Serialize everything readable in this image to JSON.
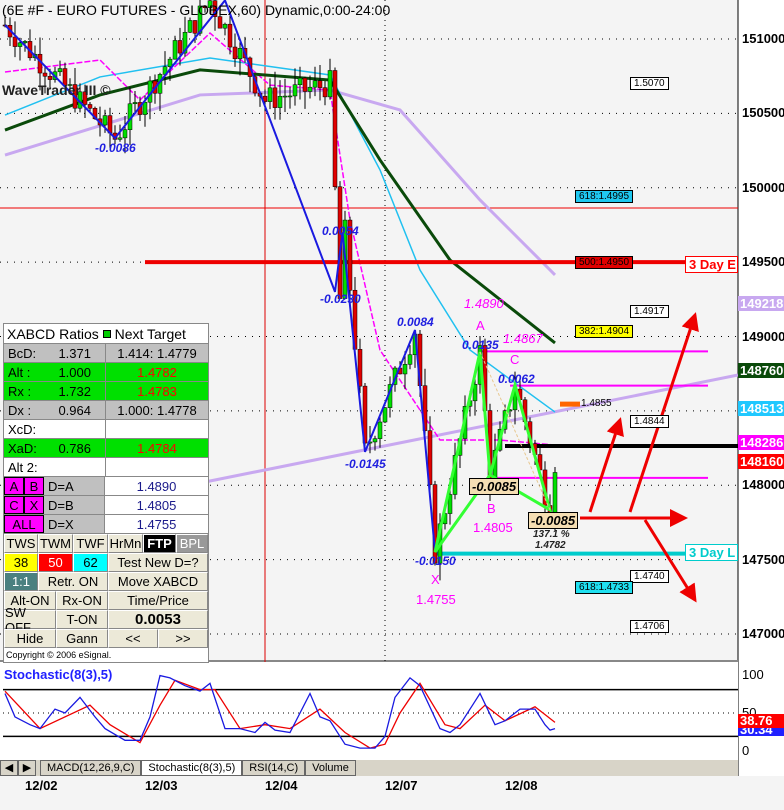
{
  "title": "(6E #F - EURO FUTURES - GLOBEX,60) Dynamic,0:00-24:00",
  "watermark": "WaveTrader III ©",
  "panel": {
    "header": "XABCD Ratios",
    "header2": "Next Target",
    "rows": [
      {
        "label": "BcD:",
        "value": "1.371",
        "target": "1.414: 1.4779",
        "style": "gray"
      },
      {
        "label": "Alt  :",
        "value": "1.000",
        "target": "1.4782",
        "style": "green"
      },
      {
        "label": "Rx   :",
        "value": "1.732",
        "target": "1.4783",
        "style": "green"
      },
      {
        "label": "Dx   :",
        "value": "0.964",
        "target": "1.000: 1.4778",
        "style": "gray"
      },
      {
        "label": "XcD:",
        "value": "",
        "target": "",
        "style": "white"
      },
      {
        "label": "XaD:",
        "value": "0.786",
        "target": "1.4784",
        "style": "green"
      },
      {
        "label": "Alt 2:",
        "value": "",
        "target": "",
        "style": "white"
      }
    ],
    "points": [
      {
        "a": "A",
        "b": "B",
        "label": "D=A",
        "value": "1.4890"
      },
      {
        "a": "C",
        "b": "X",
        "label": "D=B",
        "value": "1.4805"
      },
      {
        "a": "ALL",
        "b": "",
        "label": "D=X",
        "value": "1.4755"
      }
    ],
    "buttons": {
      "tws": "TWS",
      "twm": "TWM",
      "twf": "TWF",
      "hrmn": "HrMn",
      "ftp": "FTP",
      "bpl": "BPL",
      "n38": "38",
      "n50": "50",
      "n62": "62",
      "test": "Test New D=?",
      "r11": "1:1",
      "retr": "Retr. ON",
      "move": "Move XABCD",
      "alt": "Alt-ON",
      "rx": "Rx-ON",
      "tp": "Time/Price",
      "sw": "SW OFF",
      "ton": "T-ON",
      "tpval": "0.0053",
      "hide": "Hide",
      "gann": "Gann",
      "prev": "<<",
      "next": ">>"
    },
    "copyright": "Copyright © 2006 eSignal."
  },
  "axis": {
    "labels": [
      "151000",
      "150500",
      "150000",
      "149500",
      "149000",
      "148000",
      "147500",
      "147000"
    ],
    "badges": [
      {
        "v": "149218",
        "c": "#c8a8f0"
      },
      {
        "v": "148760",
        "c": "#0a4a0a"
      },
      {
        "v": "148513",
        "c": "#20c8ff"
      },
      {
        "v": "148286",
        "c": "#ff00ff"
      },
      {
        "v": "148160",
        "c": "#ff0000"
      }
    ]
  },
  "levels": {
    "boxes": [
      {
        "t": "1.5070",
        "p": 150700,
        "bg": "#fff"
      },
      {
        "t": "618:1.4995",
        "p": 149950,
        "bg": "#20c8f0"
      },
      {
        "t": "500:1.4950",
        "p": 149500,
        "bg": "#e00000"
      },
      {
        "t": "1.4917",
        "p": 149170,
        "bg": "#fff"
      },
      {
        "t": "382:1.4904",
        "p": 149040,
        "bg": "#ffff00"
      },
      {
        "t": "1.4844",
        "p": 148440,
        "bg": "#fff"
      },
      {
        "t": "1.4740",
        "p": 147400,
        "bg": "#fff"
      },
      {
        "t": "618:1.4733",
        "p": 147330,
        "bg": "#20e0f0"
      },
      {
        "t": "1.4706",
        "p": 147060,
        "bg": "#fff"
      }
    ],
    "orange_label": "1.4855",
    "day_high": "3 Day E",
    "day_low": "3 Day L"
  },
  "pattern": {
    "swing_labels": [
      "-0.0086",
      "0.0054",
      "-0.0230",
      "0.0084",
      "-0.0145",
      "0.0135",
      "0.0062",
      "-0.0150"
    ],
    "A": "A",
    "A_price": "1.4890",
    "B": "B",
    "B_price": "1.4805",
    "C": "C",
    "C_price": "1.4867",
    "X": "X",
    "X_price": "1.4755",
    "B_box": "-0.0085",
    "D_box": "-0.0085",
    "D_pct": "137.1 %",
    "D_price": "1.4782"
  },
  "stoch": {
    "label": "Stochastic(8(3),5)",
    "axis": [
      "100",
      "50",
      "0"
    ],
    "value_red": "38.76",
    "value_blue": "30.34"
  },
  "tabs": [
    "MACD(12,26,9,C)",
    "Stochastic(8(3),5)",
    "RSI(14,C)",
    "Volume"
  ],
  "dates": [
    "12/02",
    "12/03",
    "12/04",
    "12/07",
    "12/08"
  ],
  "chart_data": {
    "type": "candlestick",
    "ylim": [
      146900,
      151250
    ],
    "swings": [
      [
        0,
        151094
      ],
      [
        22,
        150334
      ],
      [
        41,
        151260
      ],
      [
        52,
        150590
      ],
      [
        65,
        150700
      ],
      [
        67,
        149250
      ],
      [
        68,
        149700
      ],
      [
        72,
        148224
      ],
      [
        82,
        149044
      ],
      [
        86,
        147551
      ],
      [
        95,
        148896
      ],
      [
        97,
        148069
      ],
      [
        102,
        148674
      ],
      [
        109,
        147834
      ],
      [
        110,
        148160
      ]
    ],
    "zigzag": [
      [
        0,
        151094
      ],
      [
        22,
        150334
      ],
      [
        44,
        151260
      ],
      [
        66,
        149300
      ],
      [
        67.5,
        149700
      ],
      [
        72,
        148224
      ],
      [
        82,
        149044
      ],
      [
        86,
        147551
      ]
    ],
    "xabcd": {
      "X": [
        86,
        147551
      ],
      "A": [
        95,
        148896
      ],
      "B": [
        97,
        148069
      ],
      "C": [
        102,
        148674
      ],
      "D": [
        109,
        147834
      ]
    },
    "ma_green": [
      [
        0,
        150388
      ],
      [
        19,
        150624
      ],
      [
        39,
        150792
      ],
      [
        65,
        150724
      ],
      [
        75,
        150187
      ],
      [
        89,
        149514
      ],
      [
        110,
        148957
      ]
    ],
    "ma_cyan": [
      [
        0,
        150489
      ],
      [
        19,
        150745
      ],
      [
        41,
        150872
      ],
      [
        65,
        150758
      ],
      [
        75,
        150120
      ],
      [
        83,
        149447
      ],
      [
        93,
        148909
      ],
      [
        110,
        148492
      ]
    ],
    "ma_magenta": [
      [
        0,
        150778
      ],
      [
        19,
        150859
      ],
      [
        27,
        150590
      ],
      [
        41,
        151040
      ],
      [
        53,
        150690
      ],
      [
        65,
        150657
      ],
      [
        69,
        149783
      ],
      [
        75,
        148909
      ],
      [
        87,
        148304
      ],
      [
        99,
        148304
      ],
      [
        110,
        148270
      ]
    ],
    "ma_lavender": [
      [
        0,
        150220
      ],
      [
        39,
        150624
      ],
      [
        65,
        150657
      ],
      [
        79,
        150523
      ],
      [
        95,
        149918
      ],
      [
        110,
        149414
      ]
    ],
    "stoch_blue": [
      [
        0,
        75
      ],
      [
        2,
        45
      ],
      [
        5,
        35
      ],
      [
        7,
        30
      ],
      [
        10,
        55
      ],
      [
        12,
        50
      ],
      [
        15,
        70
      ],
      [
        18,
        45
      ],
      [
        20,
        30
      ],
      [
        24,
        15
      ],
      [
        27,
        15
      ],
      [
        29,
        45
      ],
      [
        31,
        98
      ],
      [
        33,
        95
      ],
      [
        36,
        85
      ],
      [
        39,
        78
      ],
      [
        41,
        88
      ],
      [
        44,
        30
      ],
      [
        47,
        30
      ],
      [
        50,
        25
      ],
      [
        52,
        38
      ],
      [
        54,
        28
      ],
      [
        57,
        25
      ],
      [
        61,
        75
      ],
      [
        63,
        45
      ],
      [
        65,
        40
      ],
      [
        68,
        10
      ],
      [
        71,
        5
      ],
      [
        74,
        5
      ],
      [
        76,
        20
      ],
      [
        78,
        70
      ],
      [
        81,
        95
      ],
      [
        83,
        85
      ],
      [
        87,
        30
      ],
      [
        89,
        25
      ],
      [
        91,
        35
      ],
      [
        94,
        65
      ],
      [
        95,
        75
      ],
      [
        98,
        35
      ],
      [
        100,
        40
      ],
      [
        103,
        55
      ],
      [
        106,
        55
      ],
      [
        108,
        35
      ],
      [
        109,
        28
      ],
      [
        110,
        30
      ]
    ],
    "stoch_red": [
      [
        0,
        78
      ],
      [
        7,
        30
      ],
      [
        17,
        60
      ],
      [
        21,
        35
      ],
      [
        27,
        12
      ],
      [
        31,
        60
      ],
      [
        34,
        92
      ],
      [
        39,
        80
      ],
      [
        42,
        80
      ],
      [
        47,
        30
      ],
      [
        52,
        35
      ],
      [
        57,
        30
      ],
      [
        63,
        55
      ],
      [
        68,
        25
      ],
      [
        73,
        5
      ],
      [
        76,
        10
      ],
      [
        79,
        50
      ],
      [
        83,
        88
      ],
      [
        88,
        35
      ],
      [
        91,
        30
      ],
      [
        96,
        60
      ],
      [
        100,
        40
      ],
      [
        106,
        58
      ],
      [
        110,
        38
      ]
    ],
    "stoch_levels": [
      80,
      50,
      20
    ]
  }
}
